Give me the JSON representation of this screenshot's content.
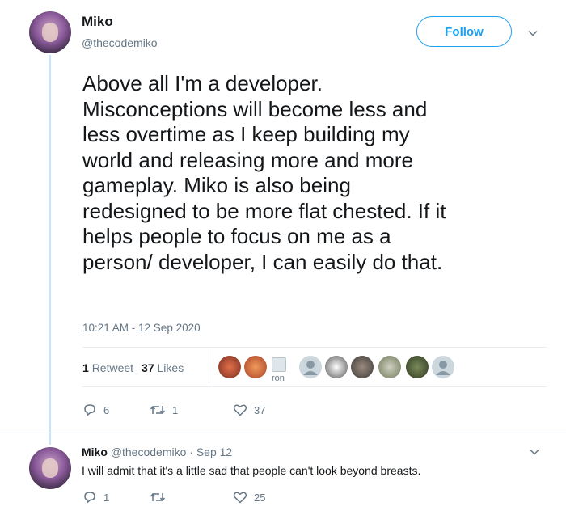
{
  "tweet": {
    "display_name": "Miko",
    "handle": "@thecodemiko",
    "follow_label": "Follow",
    "text": "Above all I'm a developer.\nMisconceptions will become less and\nless overtime as I keep building my\nworld and releasing more and more\ngameplay.  Miko is also being\nredesigned to be more flat chested. If it\nhelps people to focus on me as a\nperson/ developer, I can easily do that.",
    "timestamp": "10:21 AM - 12 Sep 2020",
    "retweet_count": "1",
    "retweet_label": "Retweet",
    "like_count": "37",
    "like_label": "Likes",
    "liker_label": "ron",
    "actions": {
      "reply_count": "6",
      "retweet_count": "1",
      "like_count": "37"
    }
  },
  "reply": {
    "display_name": "Miko",
    "handle": "@thecodemiko",
    "dot": "·",
    "date": "Sep 12",
    "text": "I will admit that it's a little sad that people can't look beyond breasts.",
    "actions": {
      "reply_count": "1",
      "retweet_count": "",
      "like_count": "25"
    }
  },
  "icons": {
    "caret": "chevron-down-icon",
    "reply": "reply-icon",
    "retweet": "retweet-icon",
    "like": "heart-icon"
  },
  "colors": {
    "accent": "#1da1f2",
    "secondary_text": "#657786",
    "thread_line": "#cde4f5"
  }
}
